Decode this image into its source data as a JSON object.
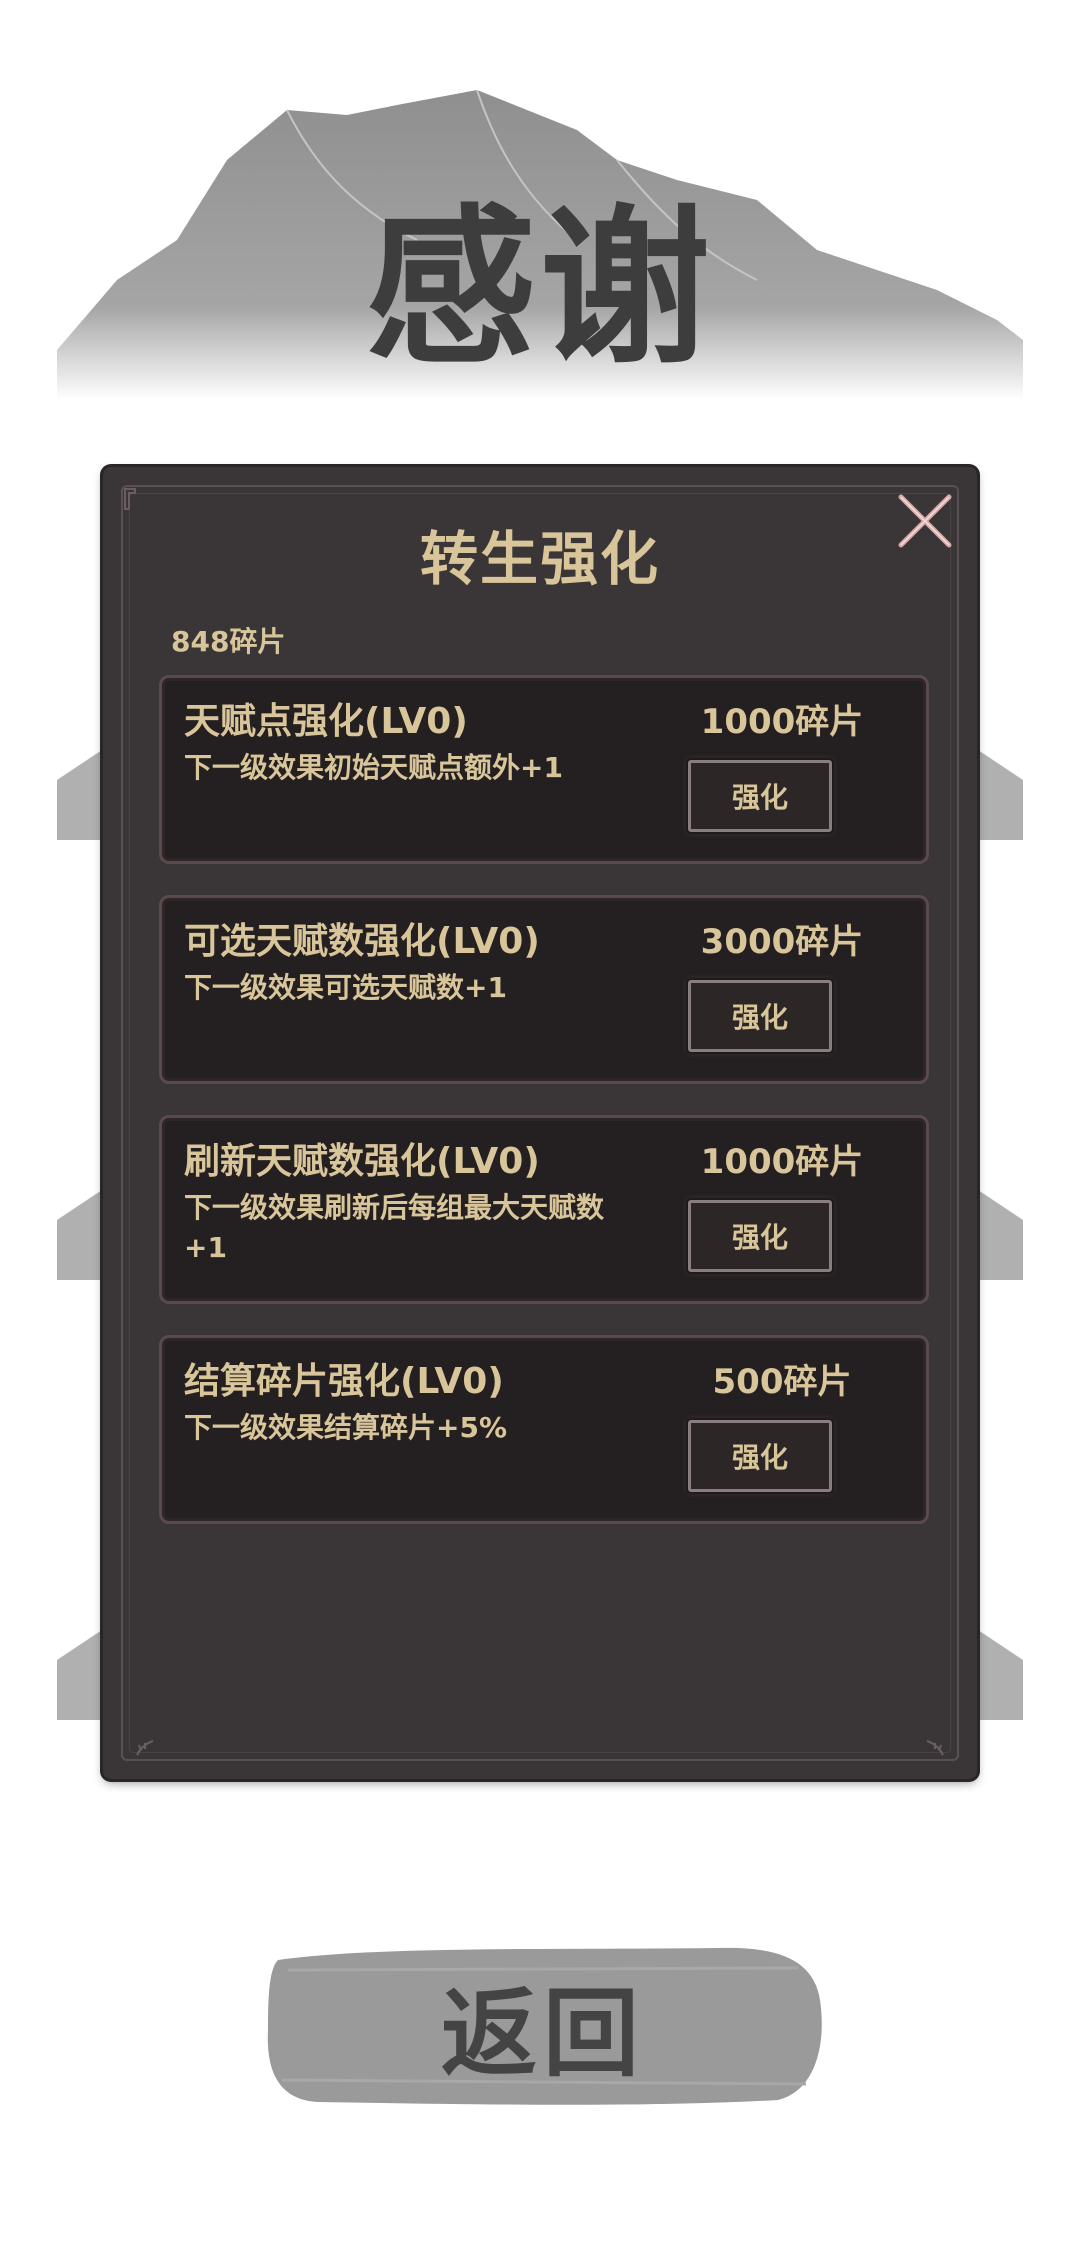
{
  "header": {
    "title": "感谢"
  },
  "panel": {
    "title": "转生强化",
    "fragments_label": "848碎片",
    "close_icon": "close-x-icon",
    "upgrades": [
      {
        "title": "天赋点强化(LV0)",
        "desc": "下一级效果初始天赋点额外+1",
        "cost": "1000碎片",
        "button": "强化"
      },
      {
        "title": "可选天赋数强化(LV0)",
        "desc": "下一级效果可选天赋数+1",
        "cost": "3000碎片",
        "button": "强化"
      },
      {
        "title": "刷新天赋数强化(LV0)",
        "desc": "下一级效果刷新后每组最大天赋数+1",
        "cost": "1000碎片",
        "button": "强化"
      },
      {
        "title": "结算碎片强化(LV0)",
        "desc": "下一级效果结算碎片+5%",
        "cost": "500碎片",
        "button": "强化"
      }
    ]
  },
  "footer": {
    "back_label": "返回"
  },
  "colors": {
    "panel_bg": "#3a3536",
    "card_bg": "#241f20",
    "accent_text": "#d9c59a",
    "close_accent": "#d7a9a9"
  }
}
